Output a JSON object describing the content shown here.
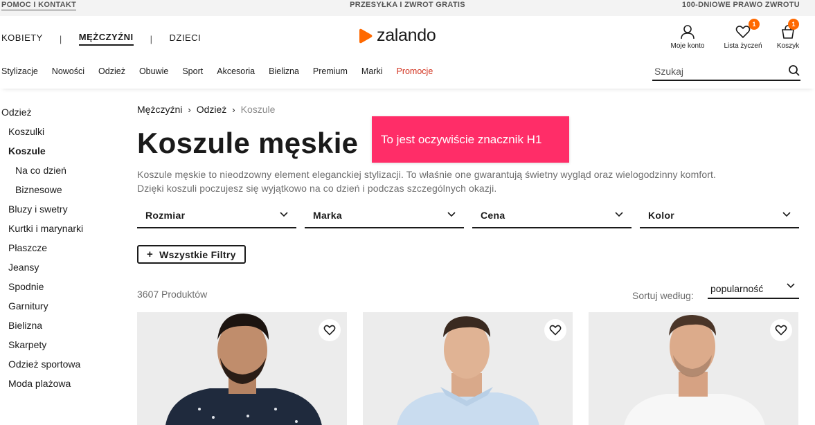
{
  "topbar": {
    "help": "POMOC I KONTAKT",
    "shipping": "PRZESYŁKA I ZWROT GRATIS",
    "returns": "100-DNIOWE PRAWO ZWROTU"
  },
  "header": {
    "gender_tabs": [
      "KOBIETY",
      "MĘŻCZYŹNI",
      "DZIECI"
    ],
    "active_gender": "MĘŻCZYŹNI",
    "logo_text": "zalando",
    "brand_color": "#ff6900",
    "account_label": "Moje konto",
    "wishlist_label": "Lista życzeń",
    "wishlist_count": "1",
    "cart_label": "Koszyk",
    "cart_count": "1"
  },
  "nav": {
    "items": [
      "Stylizacje",
      "Nowości",
      "Odzież",
      "Obuwie",
      "Sport",
      "Akcesoria",
      "Bielizna",
      "Premium",
      "Marki",
      "Promocje"
    ],
    "promo_color": "#d2321e",
    "search_placeholder": "Szukaj"
  },
  "sidebar": {
    "items": [
      {
        "label": "Odzież",
        "level": 0
      },
      {
        "label": "Koszulki",
        "level": 1
      },
      {
        "label": "Koszule",
        "level": 1,
        "active": true
      },
      {
        "label": "Na co dzień",
        "level": 2
      },
      {
        "label": "Biznesowe",
        "level": 2
      },
      {
        "label": "Bluzy i swetry",
        "level": 1
      },
      {
        "label": "Kurtki i marynarki",
        "level": 1
      },
      {
        "label": "Płaszcze",
        "level": 1
      },
      {
        "label": "Jeansy",
        "level": 1
      },
      {
        "label": "Spodnie",
        "level": 1
      },
      {
        "label": "Garnitury",
        "level": 1
      },
      {
        "label": "Bielizna",
        "level": 1
      },
      {
        "label": "Skarpety",
        "level": 1
      },
      {
        "label": "Odzież sportowa",
        "level": 1
      },
      {
        "label": "Moda plażowa",
        "level": 1
      }
    ]
  },
  "breadcrumb": [
    "Mężczyźni",
    "Odzież",
    "Koszule"
  ],
  "page": {
    "title": "Koszule męskie",
    "description": "Koszule męskie to nieodzowny element eleganckiej stylizacji. To właśnie one gwarantują świetny wygląd oraz wielogodzinny komfort. Dzięki koszuli poczujesz się wyjątkowo na co dzień i podczas szczególnych okazji.",
    "tooltip": "To jest oczywiście znacznik H1",
    "tooltip_color": "#ff2d68"
  },
  "filters": [
    "Rozmiar",
    "Marka",
    "Cena",
    "Kolor"
  ],
  "all_filters_label": "Wszystkie Filtry",
  "results": {
    "count": "3607 Produktów",
    "sort_label": "Sortuj według:",
    "sort_value": "popularność"
  },
  "products": [
    {
      "name": "dark-print-shirt",
      "shirt_color": "#1f2a3d"
    },
    {
      "name": "light-blue-shirt",
      "shirt_color": "#c9dcef"
    },
    {
      "name": "white-shirt",
      "shirt_color": "#f7f7f7"
    }
  ]
}
